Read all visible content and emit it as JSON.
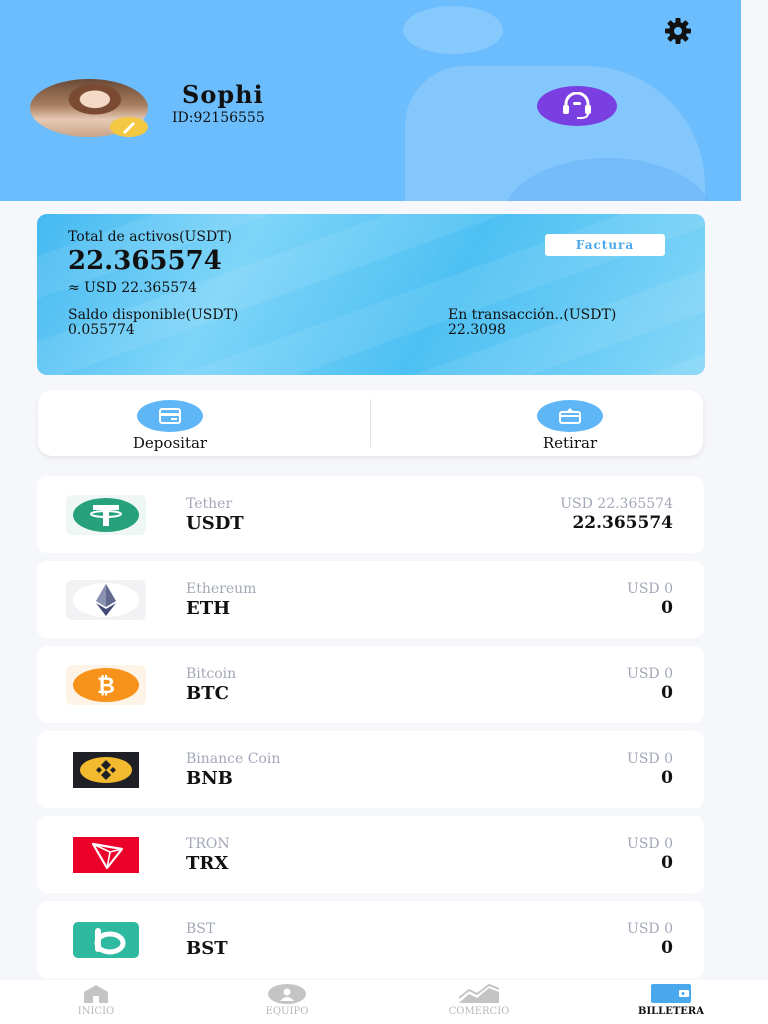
{
  "profile": {
    "name": "Sophi",
    "id_text": "ID:92156555"
  },
  "assets": {
    "total_label": "Total de activos(USDT)",
    "total_value": "22.365574",
    "total_usd": "≈ USD 22.365574",
    "invoice_button": "Factura",
    "available_label": "Saldo disponible(USDT)",
    "available_value": "0.055774",
    "in_transaction_label": "En transacción..(USDT)",
    "in_transaction_value": "22.3098"
  },
  "actions": {
    "deposit_label": "Depositar",
    "withdraw_label": "Retirar"
  },
  "coins": [
    {
      "name": "Tether",
      "symbol": "USDT",
      "usd": "USD 22.365574",
      "amount": "22.365574",
      "icon": "tether-icon",
      "color": "#26a17b"
    },
    {
      "name": "Ethereum",
      "symbol": "ETH",
      "usd": "USD 0",
      "amount": "0",
      "icon": "ethereum-icon",
      "color": "#62688f"
    },
    {
      "name": "Bitcoin",
      "symbol": "BTC",
      "usd": "USD 0",
      "amount": "0",
      "icon": "bitcoin-icon",
      "color": "#f7931a"
    },
    {
      "name": "Binance Coin",
      "symbol": "BNB",
      "usd": "USD 0",
      "amount": "0",
      "icon": "binance-icon",
      "color": "#f3ba2f"
    },
    {
      "name": "TRON",
      "symbol": "TRX",
      "usd": "USD 0",
      "amount": "0",
      "icon": "tron-icon",
      "color": "#eb0029"
    },
    {
      "name": "BST",
      "symbol": "BST",
      "usd": "USD 0",
      "amount": "0",
      "icon": "bst-icon",
      "color": "#2fb9a0"
    }
  ],
  "nav": {
    "items": [
      {
        "label": "INICIO",
        "icon": "home-icon",
        "active": false
      },
      {
        "label": "EQUIPO",
        "icon": "team-icon",
        "active": false
      },
      {
        "label": "COMERCIO",
        "icon": "chart-icon",
        "active": false
      },
      {
        "label": "BILLETERA",
        "icon": "wallet-icon",
        "active": true
      }
    ]
  },
  "colors": {
    "header_bg": "#6cbdfd",
    "accent": "#4aa9ec",
    "support": "#7a3fe0"
  }
}
